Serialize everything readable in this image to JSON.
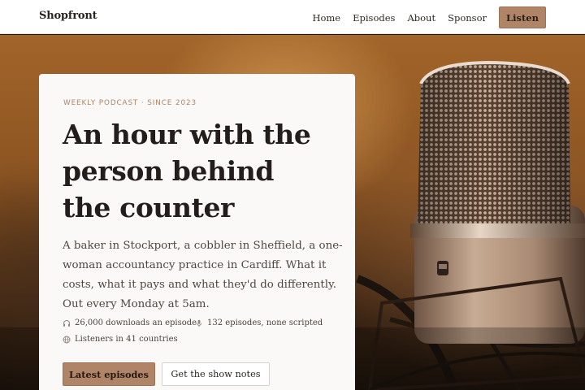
{
  "header": {
    "brand": "Shopfront",
    "nav": [
      "Home",
      "Episodes",
      "About",
      "Sponsor"
    ],
    "cta": "Listen"
  },
  "hero": {
    "image": "studio microphone",
    "eyebrow": "Weekly podcast · Since 2023",
    "title_lines": [
      "An hour with the",
      "person behind",
      "the counter"
    ],
    "lede_lines": [
      "A baker in Stockport, a cobbler in Sheffield, a one-",
      "woman accountancy practice in Cardiff. What it",
      "costs, what it pays and what they'd do differently.",
      "Out every Monday at 5am."
    ],
    "stats": [
      {
        "icon": "headphones-icon",
        "text": "26,000 downloads an episode"
      },
      {
        "icon": "microphone-icon",
        "text": "132 episodes, none scripted"
      },
      {
        "icon": "globe-icon",
        "text": "Listeners in 41 countries"
      }
    ],
    "primary_button": "Latest episodes",
    "secondary_button": "Get the show notes"
  },
  "colors": {
    "accent": "#b08466",
    "eyebrow": "#b2835f",
    "ink": "#231e1b",
    "card": "#fbf9f7"
  }
}
